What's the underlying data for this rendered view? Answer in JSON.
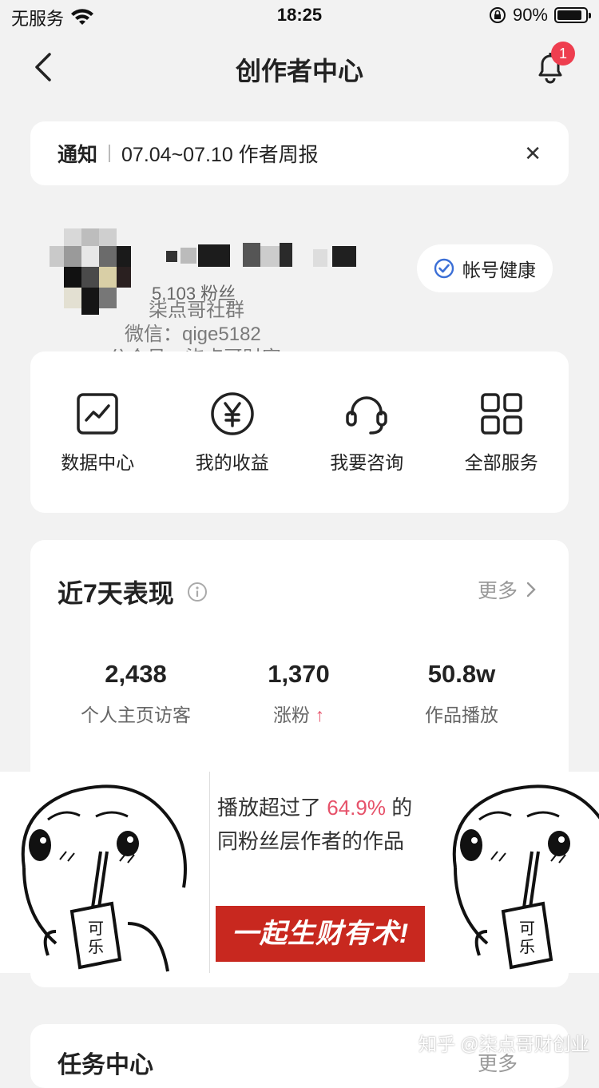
{
  "status_bar": {
    "carrier": "无服务",
    "time": "18:25",
    "battery": "90%",
    "battery_level": 0.9
  },
  "nav": {
    "title": "创作者中心",
    "notification_count": "1"
  },
  "notice": {
    "tag": "通知",
    "text": "07.04~07.10 作者周报",
    "close": "✕"
  },
  "profile": {
    "fans": "5,103 粉丝",
    "health_button": "帐号健康"
  },
  "watermark": {
    "line1": "柒点哥社群",
    "line2": "微信：qige5182",
    "line3": "公众号：柒点哥财富"
  },
  "services": [
    {
      "label": "数据中心",
      "icon": "chart-icon"
    },
    {
      "label": "我的收益",
      "icon": "yen-icon"
    },
    {
      "label": "我要咨询",
      "icon": "headset-icon"
    },
    {
      "label": "全部服务",
      "icon": "grid-icon"
    }
  ],
  "performance": {
    "title": "近7天表现",
    "more": "更多",
    "stats": [
      {
        "value": "2,438",
        "label": "个人主页访客"
      },
      {
        "value": "1,370",
        "label": "涨粉",
        "trend": "↑"
      },
      {
        "value": "50.8w",
        "label": "作品播放"
      }
    ],
    "comparison_prefix": "播放超过了",
    "comparison_pct": "64.9%",
    "comparison_suffix": "的",
    "comparison_line2": "同粉丝层作者的作品",
    "banner": "一起生财有术!"
  },
  "meme": {
    "cup_text": "可乐"
  },
  "task": {
    "title": "任务中心",
    "more": "更多"
  },
  "site_watermark": "知乎 @柒点哥财创业",
  "colors": {
    "accent_red": "#e6526a",
    "badge_red": "#ee3e4f",
    "banner_red": "#c8281f",
    "health_blue": "#3b6fd6"
  }
}
